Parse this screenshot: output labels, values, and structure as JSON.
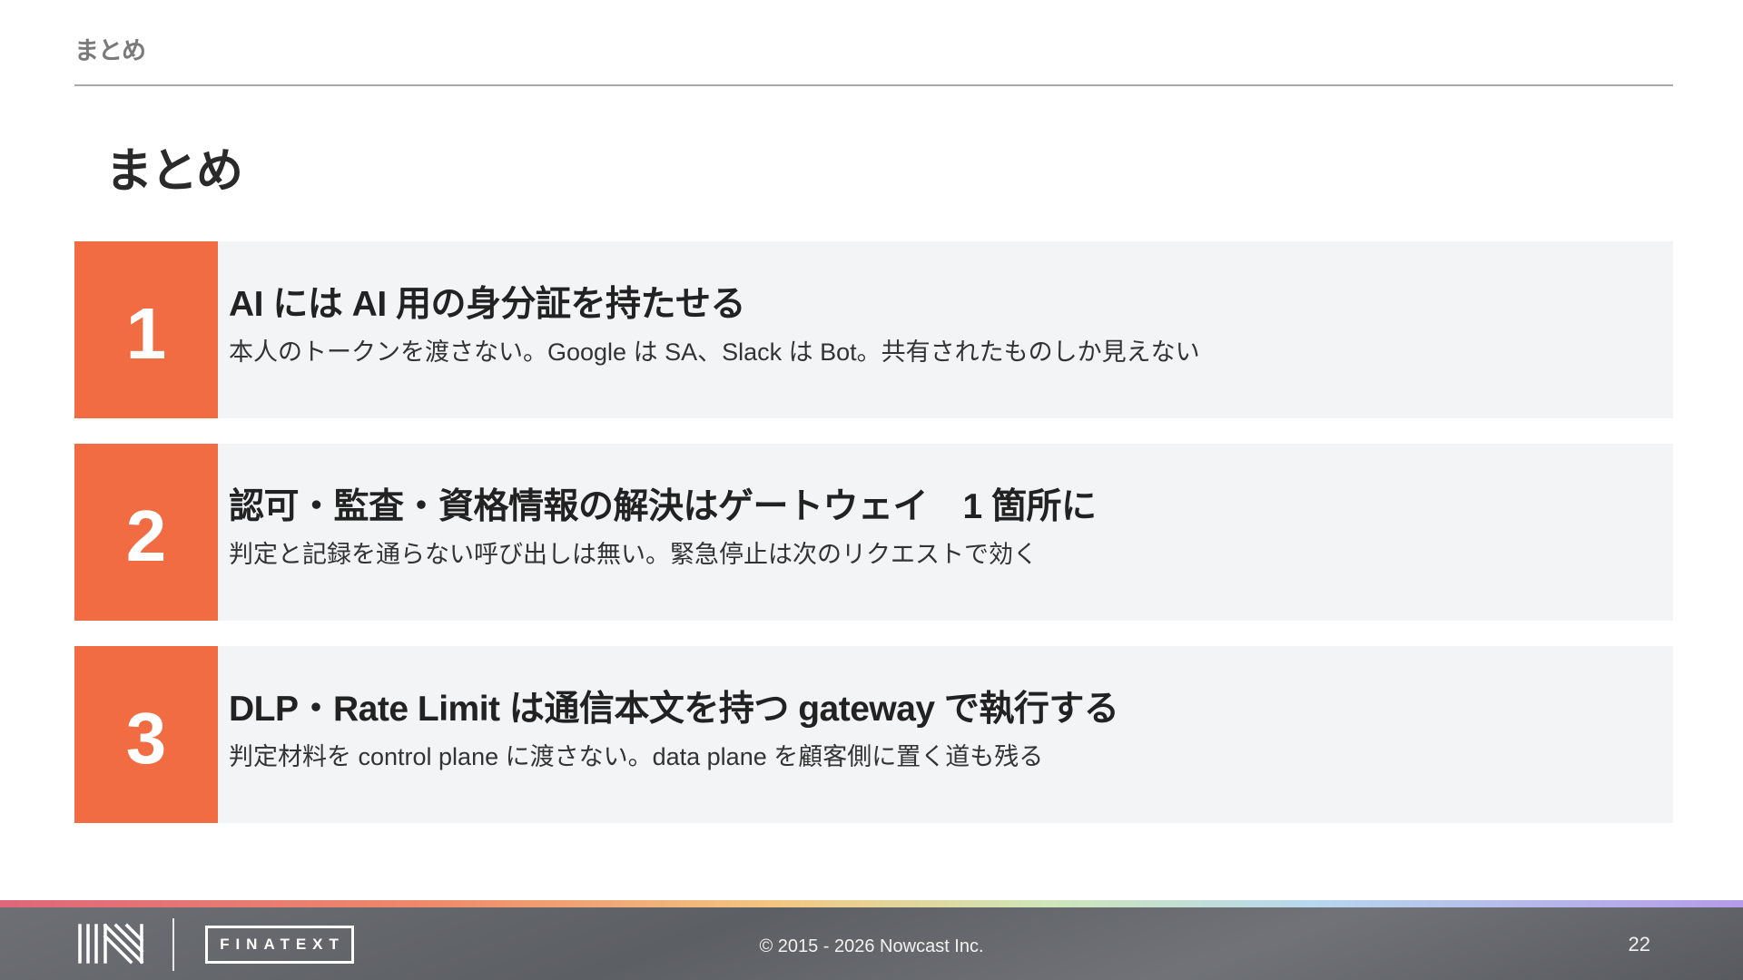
{
  "header": {
    "section_label": "まとめ"
  },
  "page_title": "まとめ",
  "cards": [
    {
      "number": "1",
      "title": "AI には AI 用の身分証を持たせる",
      "description": "本人のトークンを渡さない。Google は SA、Slack は Bot。共有されたものしか見えない"
    },
    {
      "number": "2",
      "title": "認可・監査・資格情報の解決はゲートウェイ　1 箇所に",
      "description": "判定と記録を通らない呼び出しは無い。緊急停止は次のリクエストで効く"
    },
    {
      "number": "3",
      "title": "DLP・Rate Limit は通信本文を持つ  gateway で執行する",
      "description": "判定材料を control plane に渡さない。data plane を顧客側に置く道も残る"
    }
  ],
  "footer": {
    "brand": "FINATEXT",
    "copyright": "© 2015 - 2026 Nowcast Inc.",
    "page_number": "22"
  },
  "colors": {
    "accent": "#f26c43",
    "card_background": "#f3f4f6",
    "footer_background": "#5c5f64"
  },
  "icons": {
    "footer_logo": "nowcast-logo-icon"
  }
}
